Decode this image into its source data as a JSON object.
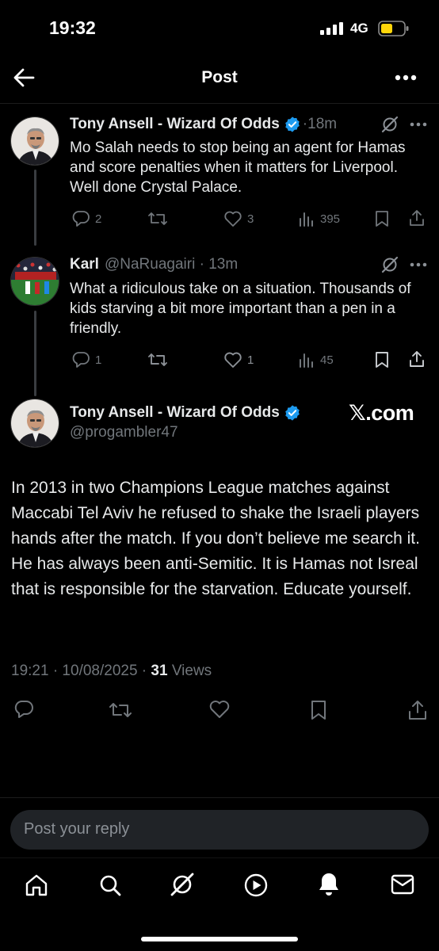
{
  "status_bar": {
    "time": "19:32",
    "network": "4G"
  },
  "header": {
    "title": "Post"
  },
  "thread": [
    {
      "name": "Tony Ansell - Wizard Of Odds",
      "time": "·18m",
      "text": "Mo Salah needs to stop being an agent for Hamas and score penalties when it matters for Liverpool. Well done Crystal Palace.",
      "replies": "2",
      "reposts": "",
      "likes": "3",
      "views": "395"
    },
    {
      "name": "Karl",
      "handle_time": "@NaRuagairi · 13m",
      "text": "What a ridiculous take on a situation. Thousands of kids starving a bit more important than a pen in a friendly.",
      "replies": "1",
      "reposts": "",
      "likes": "1",
      "views": "45"
    }
  ],
  "main_post": {
    "name": "Tony Ansell - Wizard Of Odds",
    "handle": "@progambler47",
    "watermark": "𝕏.com",
    "text": "In 2013 in two Champions League matches against Maccabi Tel Aviv he refused to shake the Israeli players hands after the match. If you don’t believe me search it. He has always been anti-Semitic. It is Hamas not Isreal that is responsible for the starvation. Educate yourself.",
    "timestamp": "19:21 · 10/08/2025 · ",
    "views_count": "31",
    "views_label": " Views"
  },
  "reply": {
    "placeholder": "Post your reply"
  },
  "tabbar": {
    "icons": [
      "home-icon",
      "search-icon",
      "grok-icon",
      "video-icon",
      "notifications-icon",
      "messages-icon"
    ]
  },
  "colors": {
    "verified": "#1d9bf0",
    "battery": "#ffd60a",
    "muted": "#71767b"
  }
}
